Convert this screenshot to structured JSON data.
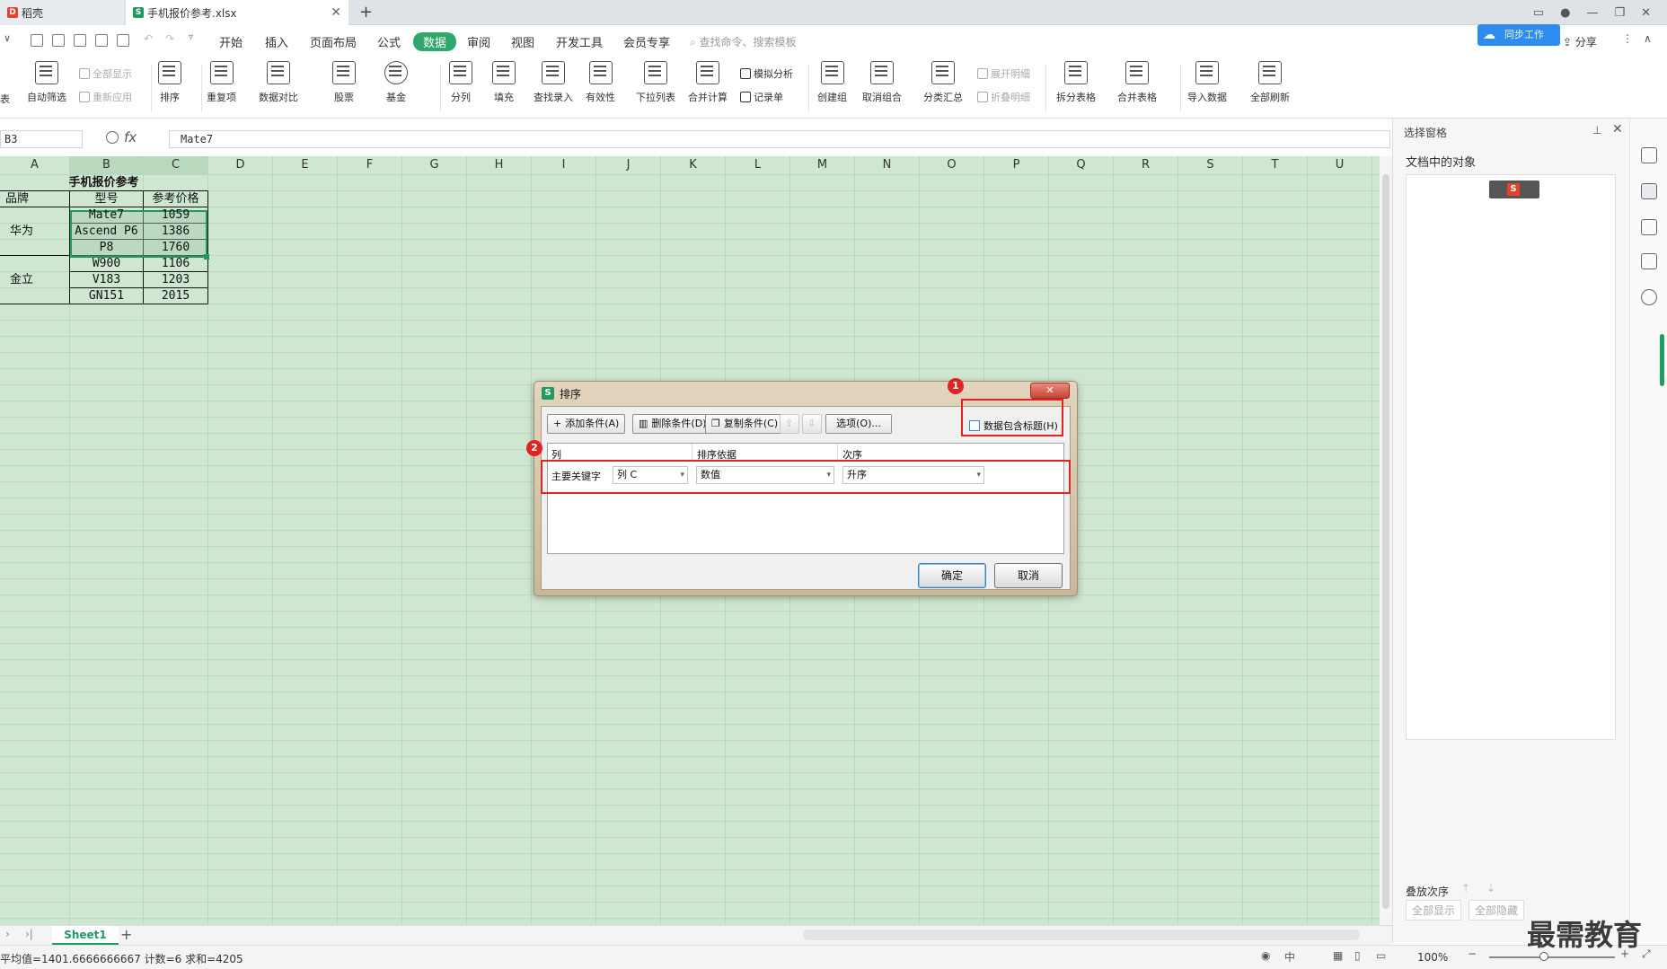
{
  "tabs": [
    {
      "label": "稻壳",
      "icon": "daoke-icon"
    },
    {
      "label": "手机报价参考.xlsx",
      "icon": "spreadsheet-icon"
    }
  ],
  "menus": [
    "开始",
    "插入",
    "页面布局",
    "公式",
    "数据",
    "审阅",
    "视图",
    "开发工具",
    "会员专享"
  ],
  "active_menu": "数据",
  "search_placeholder": "查找命令、搜索模板",
  "cloud_label": "同步工作",
  "share_label": "分享",
  "ribbon": {
    "auto_filter": "自动筛选",
    "show_all": "全部显示",
    "reapply": "重新应用",
    "sort": "排序",
    "duplicates": "重复项",
    "data_compare": "数据对比",
    "stock": "股票",
    "fund": "基金",
    "split_column": "分列",
    "fill": "填充",
    "lookup_entry": "查找录入",
    "validity": "有效性",
    "dropdown_list": "下拉列表",
    "consolidate": "合并计算",
    "what_if": "模拟分析",
    "record": "记录单",
    "create_group": "创建组",
    "ungroup": "取消组合",
    "subtotal": "分类汇总",
    "expand_detail": "展开明细",
    "collapse_detail": "折叠明细",
    "split_table": "拆分表格",
    "merge_table": "合并表格",
    "import_data": "导入数据",
    "refresh_all": "全部刷新",
    "left_cut": "表"
  },
  "formula_bar": {
    "name_box": "B3",
    "fx": "fx",
    "value": "Mate7"
  },
  "columns": [
    "A",
    "B",
    "C",
    "D",
    "E",
    "F",
    "G",
    "H",
    "I",
    "J",
    "K",
    "L",
    "M",
    "N",
    "O",
    "P",
    "Q",
    "R",
    "S",
    "T",
    "U"
  ],
  "table": {
    "title": "手机报价参考",
    "headers": [
      "品牌",
      "型号",
      "参考价格"
    ],
    "brands": [
      "华为",
      "金立"
    ],
    "rows": [
      {
        "model": "Mate7",
        "price": "1059"
      },
      {
        "model": "Ascend P6",
        "price": "1386"
      },
      {
        "model": "P8",
        "price": "1760"
      },
      {
        "model": "W900",
        "price": "1106"
      },
      {
        "model": "V183",
        "price": "1203"
      },
      {
        "model": "GN151",
        "price": "2015"
      }
    ]
  },
  "right_pane": {
    "title": "选择窗格",
    "subtitle": "文档中的对象",
    "order_label": "叠放次序",
    "show_all": "全部显示",
    "hide_all": "全部隐藏"
  },
  "dialog": {
    "title": "排序",
    "add": "添加条件(A)",
    "delete": "删除条件(D)",
    "copy": "复制条件(C)",
    "options": "选项(O)...",
    "header_checkbox": "数据包含标题(H)",
    "header_checked": false,
    "col_header": "列",
    "basis_header": "排序依据",
    "order_header": "次序",
    "key_label": "主要关键字",
    "column_value": "列 C",
    "basis_value": "数值",
    "order_value": "升序",
    "ok": "确定",
    "cancel": "取消",
    "badge1": "1",
    "badge2": "2"
  },
  "sheet_tab": "Sheet1",
  "status": "平均值=1401.6666666667  计数=6  求和=4205",
  "zoom": "100%",
  "watermark": "最需教育",
  "colors": {
    "accent": "#2fa86c",
    "grid_bg": "#cfe7d1",
    "highlight": "#e02323"
  }
}
